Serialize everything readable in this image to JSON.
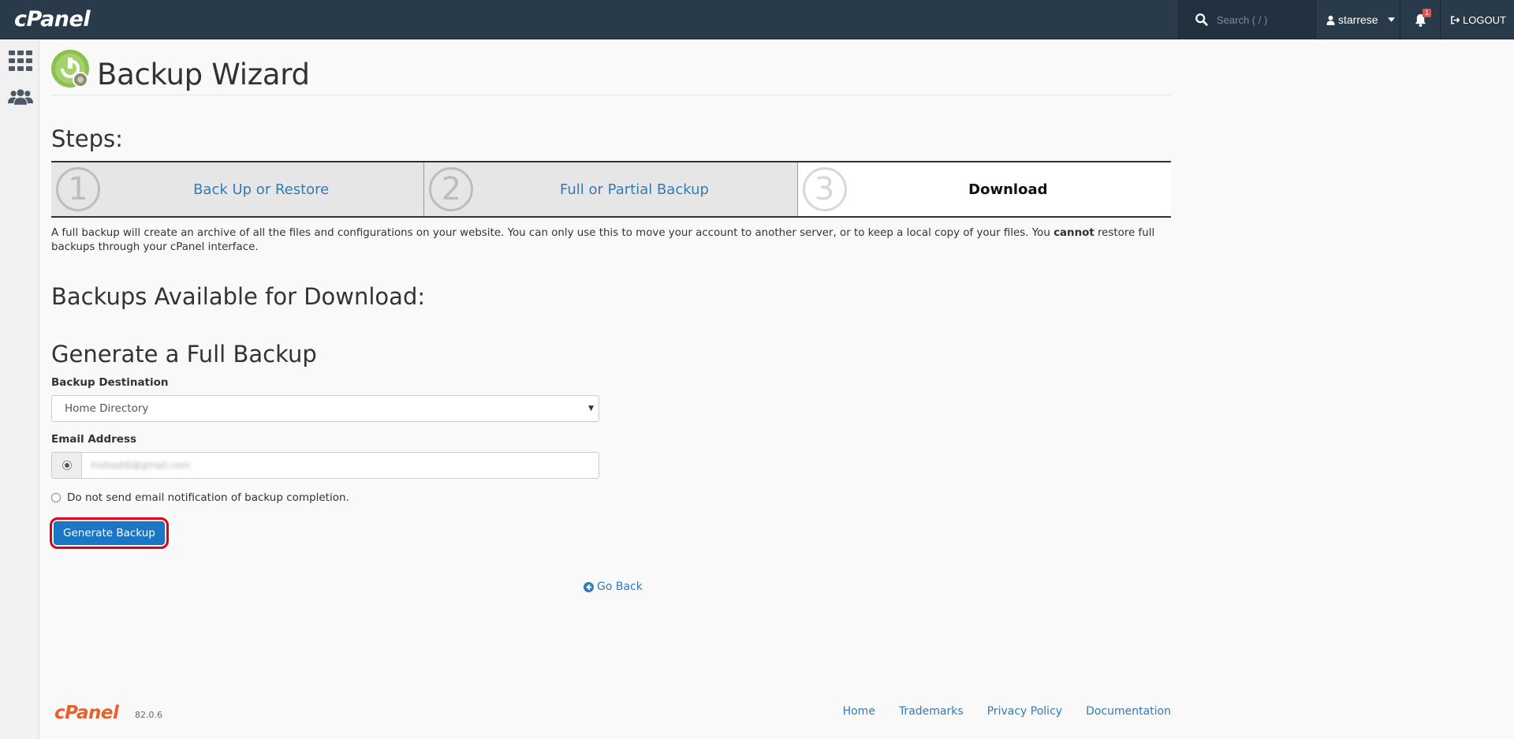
{
  "header": {
    "logo": "cPanel",
    "search_placeholder": "Search ( / )",
    "username": "starrese",
    "notification_count": "1",
    "logout_label": "LOGOUT"
  },
  "page": {
    "title": "Backup Wizard",
    "steps_heading": "Steps:",
    "steps": [
      {
        "number": "1",
        "label": "Back Up or Restore",
        "active": false
      },
      {
        "number": "2",
        "label": "Full or Partial Backup",
        "active": false
      },
      {
        "number": "3",
        "label": "Download",
        "active": true
      }
    ],
    "description_part1": "A full backup will create an archive of all the files and configurations on your website. You can only use this to move your account to another server, or to keep a local copy of your files. You ",
    "description_bold": "cannot",
    "description_part2": " restore full backups through your cPanel interface.",
    "available_heading": "Backups Available for Download:",
    "generate_heading": "Generate a Full Backup",
    "destination_label": "Backup Destination",
    "destination_value": "Home Directory",
    "email_label": "Email Address",
    "email_value": "mohaddi@gmail.com",
    "no_notify_label": "Do not send email notification of backup completion.",
    "generate_button": "Generate Backup",
    "go_back": "Go Back"
  },
  "footer": {
    "logo": "cPanel",
    "version": "82.0.6",
    "links": [
      "Home",
      "Trademarks",
      "Privacy Policy",
      "Documentation"
    ]
  },
  "colors": {
    "topbar": "#293a4a",
    "link": "#337ab7",
    "primary_button": "#1b76c4",
    "highlight": "#e0001b",
    "footer_logo": "#e8602a"
  }
}
